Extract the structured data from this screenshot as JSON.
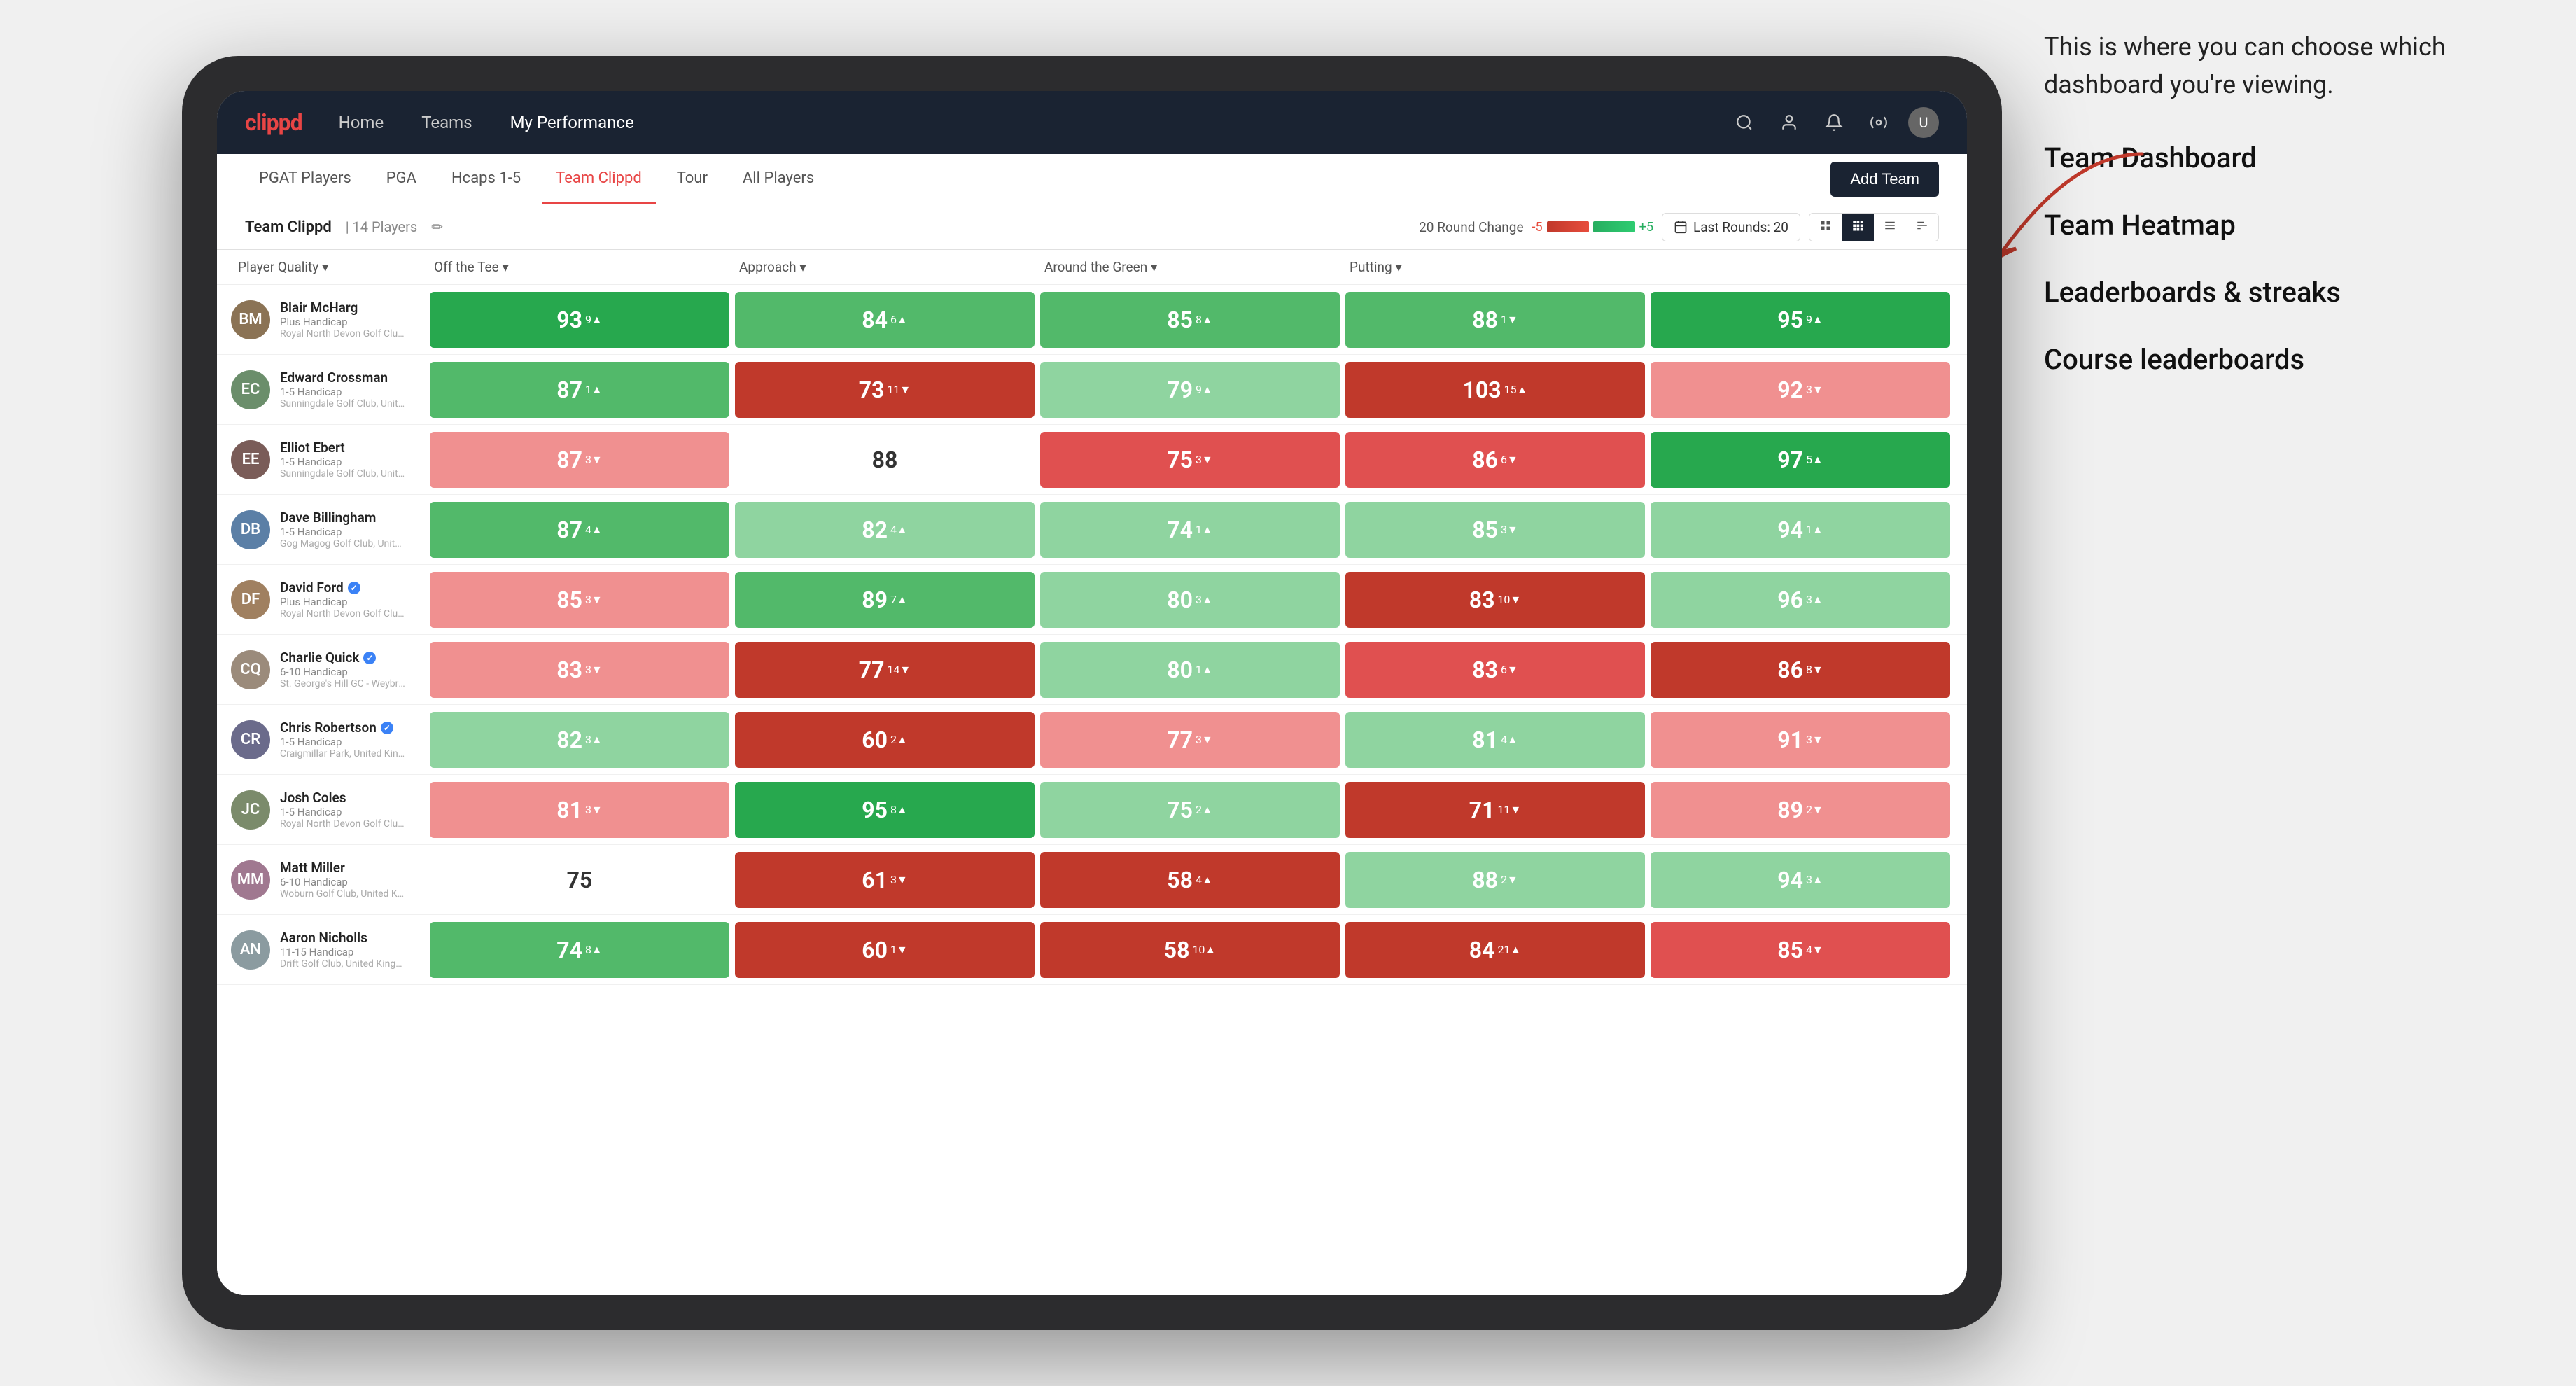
{
  "annotation": {
    "intro": "This is where you can choose which dashboard you're viewing.",
    "items": [
      "Team Dashboard",
      "Team Heatmap",
      "Leaderboards & streaks",
      "Course leaderboards"
    ]
  },
  "nav": {
    "logo": "clippd",
    "items": [
      "Home",
      "Teams",
      "My Performance"
    ],
    "active": "My Performance"
  },
  "sub_nav": {
    "items": [
      "PGAT Players",
      "PGA",
      "Hcaps 1-5",
      "Team Clippd",
      "Tour",
      "All Players"
    ],
    "active": "Team Clippd",
    "add_btn": "Add Team"
  },
  "team_header": {
    "name": "Team Clippd",
    "separator": "|",
    "count": "14 Players",
    "round_change_label": "20 Round Change",
    "neg": "-5",
    "pos": "+5",
    "last_rounds_label": "Last Rounds:",
    "last_rounds_value": "20"
  },
  "col_headers": [
    "Player Quality ▾",
    "Off the Tee ▾",
    "Approach ▾",
    "Around the Green ▾",
    "Putting ▾"
  ],
  "players": [
    {
      "name": "Blair McHarg",
      "handicap": "Plus Handicap",
      "club": "Royal North Devon Golf Club, United Kingdom",
      "avatar_color": "#8B7355",
      "initials": "BM",
      "stats": [
        {
          "value": "93",
          "change": "9",
          "dir": "up",
          "color": "bg-green-dark"
        },
        {
          "value": "84",
          "change": "6",
          "dir": "up",
          "color": "bg-green-mid"
        },
        {
          "value": "85",
          "change": "8",
          "dir": "up",
          "color": "bg-green-mid"
        },
        {
          "value": "88",
          "change": "1",
          "dir": "down",
          "color": "bg-green-mid"
        },
        {
          "value": "95",
          "change": "9",
          "dir": "up",
          "color": "bg-green-dark"
        }
      ]
    },
    {
      "name": "Edward Crossman",
      "handicap": "1-5 Handicap",
      "club": "Sunningdale Golf Club, United Kingdom",
      "avatar_color": "#6B8E6B",
      "initials": "EC",
      "stats": [
        {
          "value": "87",
          "change": "1",
          "dir": "up",
          "color": "bg-green-mid"
        },
        {
          "value": "73",
          "change": "11",
          "dir": "down",
          "color": "bg-red-dark"
        },
        {
          "value": "79",
          "change": "9",
          "dir": "up",
          "color": "bg-green-light"
        },
        {
          "value": "103",
          "change": "15",
          "dir": "up",
          "color": "bg-red-dark"
        },
        {
          "value": "92",
          "change": "3",
          "dir": "down",
          "color": "bg-red-light"
        }
      ]
    },
    {
      "name": "Elliot Ebert",
      "handicap": "1-5 Handicap",
      "club": "Sunningdale Golf Club, United Kingdom",
      "avatar_color": "#7A5C58",
      "initials": "EE",
      "stats": [
        {
          "value": "87",
          "change": "3",
          "dir": "down",
          "color": "bg-red-light"
        },
        {
          "value": "88",
          "change": "",
          "dir": "",
          "color": "bg-white"
        },
        {
          "value": "75",
          "change": "3",
          "dir": "down",
          "color": "bg-red-mid"
        },
        {
          "value": "86",
          "change": "6",
          "dir": "down",
          "color": "bg-red-mid"
        },
        {
          "value": "97",
          "change": "5",
          "dir": "up",
          "color": "bg-green-dark"
        }
      ]
    },
    {
      "name": "Dave Billingham",
      "handicap": "1-5 Handicap",
      "club": "Gog Magog Golf Club, United Kingdom",
      "avatar_color": "#5B7FA6",
      "initials": "DB",
      "stats": [
        {
          "value": "87",
          "change": "4",
          "dir": "up",
          "color": "bg-green-mid"
        },
        {
          "value": "82",
          "change": "4",
          "dir": "up",
          "color": "bg-green-light"
        },
        {
          "value": "74",
          "change": "1",
          "dir": "up",
          "color": "bg-green-light"
        },
        {
          "value": "85",
          "change": "3",
          "dir": "down",
          "color": "bg-green-light"
        },
        {
          "value": "94",
          "change": "1",
          "dir": "up",
          "color": "bg-green-light"
        }
      ]
    },
    {
      "name": "David Ford",
      "handicap": "Plus Handicap",
      "club": "Royal North Devon Golf Club, United Kingdom",
      "avatar_color": "#A08060",
      "initials": "DF",
      "verified": true,
      "stats": [
        {
          "value": "85",
          "change": "3",
          "dir": "down",
          "color": "bg-red-light"
        },
        {
          "value": "89",
          "change": "7",
          "dir": "up",
          "color": "bg-green-mid"
        },
        {
          "value": "80",
          "change": "3",
          "dir": "up",
          "color": "bg-green-light"
        },
        {
          "value": "83",
          "change": "10",
          "dir": "down",
          "color": "bg-red-dark"
        },
        {
          "value": "96",
          "change": "3",
          "dir": "up",
          "color": "bg-green-light"
        }
      ]
    },
    {
      "name": "Charlie Quick",
      "handicap": "6-10 Handicap",
      "club": "St. George's Hill GC - Weybridge, Surrey, Uni...",
      "avatar_color": "#9B8B7B",
      "initials": "CQ",
      "verified": true,
      "stats": [
        {
          "value": "83",
          "change": "3",
          "dir": "down",
          "color": "bg-red-light"
        },
        {
          "value": "77",
          "change": "14",
          "dir": "down",
          "color": "bg-red-dark"
        },
        {
          "value": "80",
          "change": "1",
          "dir": "up",
          "color": "bg-green-light"
        },
        {
          "value": "83",
          "change": "6",
          "dir": "down",
          "color": "bg-red-mid"
        },
        {
          "value": "86",
          "change": "8",
          "dir": "down",
          "color": "bg-red-dark"
        }
      ]
    },
    {
      "name": "Chris Robertson",
      "handicap": "1-5 Handicap",
      "club": "Craigmillar Park, United Kingdom",
      "avatar_color": "#6B6B8B",
      "initials": "CR",
      "verified": true,
      "stats": [
        {
          "value": "82",
          "change": "3",
          "dir": "up",
          "color": "bg-green-light"
        },
        {
          "value": "60",
          "change": "2",
          "dir": "up",
          "color": "bg-red-dark"
        },
        {
          "value": "77",
          "change": "3",
          "dir": "down",
          "color": "bg-red-light"
        },
        {
          "value": "81",
          "change": "4",
          "dir": "up",
          "color": "bg-green-light"
        },
        {
          "value": "91",
          "change": "3",
          "dir": "down",
          "color": "bg-red-light"
        }
      ]
    },
    {
      "name": "Josh Coles",
      "handicap": "1-5 Handicap",
      "club": "Royal North Devon Golf Club, United Kingdom",
      "avatar_color": "#7B8B6B",
      "initials": "JC",
      "stats": [
        {
          "value": "81",
          "change": "3",
          "dir": "down",
          "color": "bg-red-light"
        },
        {
          "value": "95",
          "change": "8",
          "dir": "up",
          "color": "bg-green-dark"
        },
        {
          "value": "75",
          "change": "2",
          "dir": "up",
          "color": "bg-green-light"
        },
        {
          "value": "71",
          "change": "11",
          "dir": "down",
          "color": "bg-red-dark"
        },
        {
          "value": "89",
          "change": "2",
          "dir": "down",
          "color": "bg-red-light"
        }
      ]
    },
    {
      "name": "Matt Miller",
      "handicap": "6-10 Handicap",
      "club": "Woburn Golf Club, United Kingdom",
      "avatar_color": "#A07890",
      "initials": "MM",
      "stats": [
        {
          "value": "75",
          "change": "",
          "dir": "",
          "color": "bg-white"
        },
        {
          "value": "61",
          "change": "3",
          "dir": "down",
          "color": "bg-red-dark"
        },
        {
          "value": "58",
          "change": "4",
          "dir": "up",
          "color": "bg-red-dark"
        },
        {
          "value": "88",
          "change": "2",
          "dir": "down",
          "color": "bg-green-light"
        },
        {
          "value": "94",
          "change": "3",
          "dir": "up",
          "color": "bg-green-light"
        }
      ]
    },
    {
      "name": "Aaron Nicholls",
      "handicap": "11-15 Handicap",
      "club": "Drift Golf Club, United Kingdom",
      "avatar_color": "#8B9BA0",
      "initials": "AN",
      "stats": [
        {
          "value": "74",
          "change": "8",
          "dir": "up",
          "color": "bg-green-mid"
        },
        {
          "value": "60",
          "change": "1",
          "dir": "down",
          "color": "bg-red-dark"
        },
        {
          "value": "58",
          "change": "10",
          "dir": "up",
          "color": "bg-red-dark"
        },
        {
          "value": "84",
          "change": "21",
          "dir": "up",
          "color": "bg-red-dark"
        },
        {
          "value": "85",
          "change": "4",
          "dir": "down",
          "color": "bg-red-mid"
        }
      ]
    }
  ]
}
